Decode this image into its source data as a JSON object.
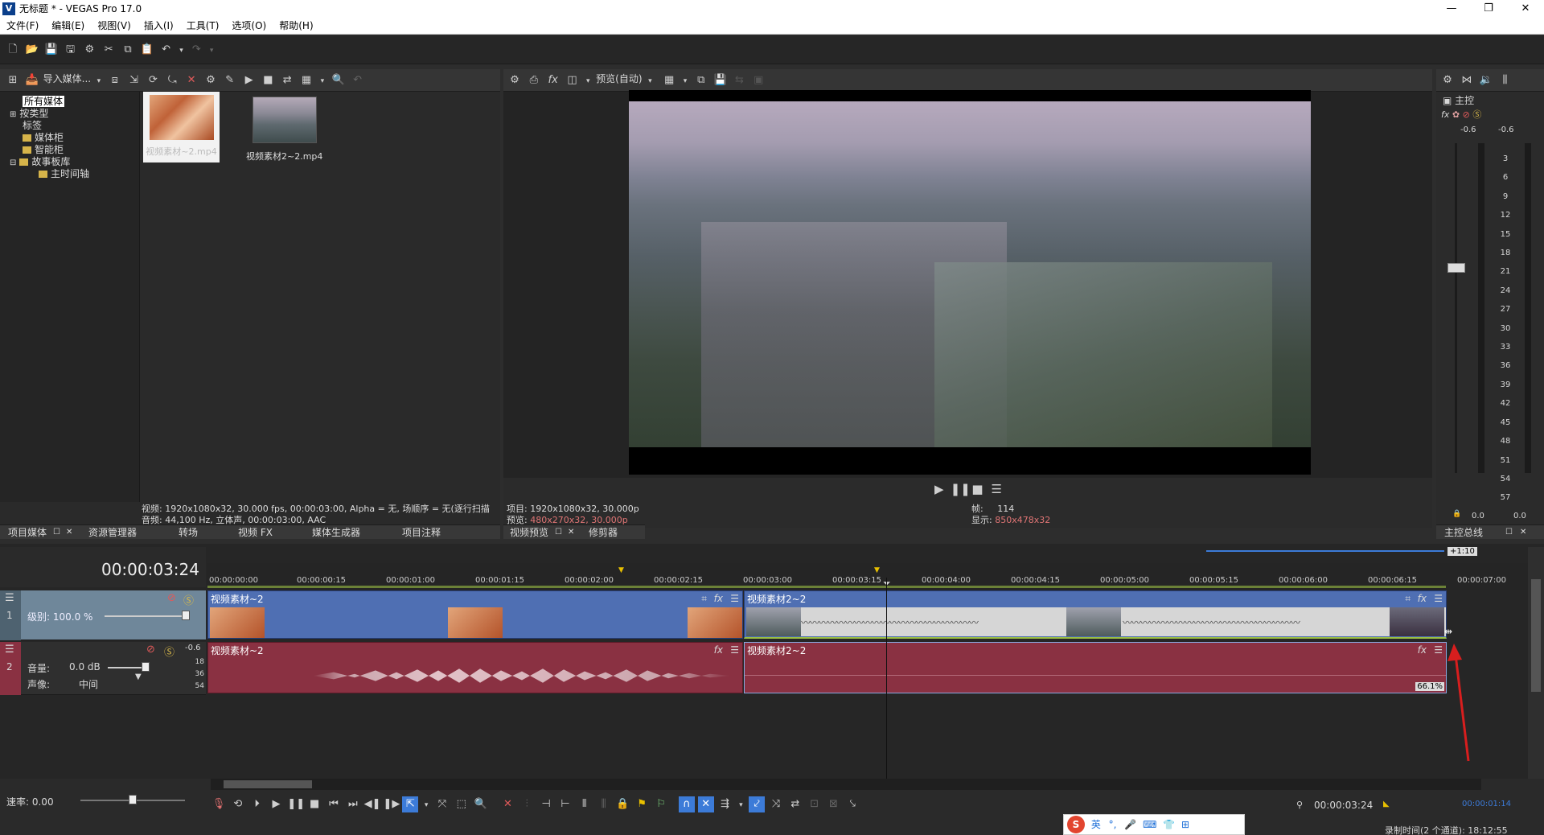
{
  "titlebar": {
    "title": "无标题 * - VEGAS Pro 17.0",
    "logo": "V"
  },
  "menu": [
    "文件(F)",
    "编辑(E)",
    "视图(V)",
    "插入(I)",
    "工具(T)",
    "选项(O)",
    "帮助(H)"
  ],
  "media_panel": {
    "import_label": "导入媒体...",
    "tree": [
      {
        "label": "所有媒体",
        "selected": true
      },
      {
        "label": "按类型"
      },
      {
        "label": "标签"
      },
      {
        "label": "媒体柜"
      },
      {
        "label": "智能柜"
      },
      {
        "label": "故事板库"
      },
      {
        "label": "主时间轴"
      }
    ],
    "thumbs": [
      {
        "label": "视频素材~2.mp4"
      },
      {
        "label": "视频素材2~2.mp4"
      }
    ],
    "info_video": "视频: 1920x1080x32, 30.000 fps, 00:00:03:00, Alpha = 无, 场顺序 = 无(逐行扫描",
    "info_audio": "音频: 44,100 Hz, 立体声, 00:00:03:00, AAC",
    "tabs": [
      "项目媒体",
      "资源管理器",
      "转场",
      "视频 FX",
      "媒体生成器",
      "项目注释"
    ]
  },
  "preview_panel": {
    "mode": "预览(自动)",
    "project": "项目: 1920x1080x32, 30.000p",
    "preview_label": "预览:",
    "preview_val": "480x270x32, 30.000p",
    "frame_label": "帧:",
    "frame_val": "114",
    "display_label": "显示:",
    "display_val": "850x478x32",
    "tabs": [
      "视频预览",
      "修剪器"
    ]
  },
  "master": {
    "label": "主控",
    "peak_l": "-0.6",
    "peak_r": "-0.6",
    "scale": [
      "3",
      "6",
      "9",
      "12",
      "15",
      "18",
      "21",
      "24",
      "27",
      "30",
      "33",
      "36",
      "39",
      "42",
      "45",
      "48",
      "51",
      "54",
      "57"
    ],
    "bottom_l": "0.0",
    "bottom_r": "0.0",
    "tab": "主控总线"
  },
  "timeline": {
    "timecode": "00:00:03:24",
    "zoom": "+1:10",
    "ruler": [
      "00:00:00:00",
      "00:00:00:15",
      "00:00:01:00",
      "00:00:01:15",
      "00:00:02:00",
      "00:00:02:15",
      "00:00:03:00",
      "00:00:03:15",
      "00:00:04:00",
      "00:00:04:15",
      "00:00:05:00",
      "00:00:05:15",
      "00:00:06:00",
      "00:00:06:15",
      "00:00:07:00"
    ],
    "video_track": {
      "num": "1",
      "level": "级别: 100.0 %"
    },
    "audio_track": {
      "num": "2",
      "volume_label": "音量:",
      "volume": "0.0 dB",
      "pan_label": "声像:",
      "pan": "中间",
      "peak": "-0.6",
      "scale": [
        "18",
        "36",
        "54"
      ]
    },
    "clips": {
      "v1": "视频素材~2",
      "v2": "视频素材2~2",
      "a1": "视频素材~2",
      "a2": "视频素材2~2",
      "a2_pct": "66.1%"
    },
    "rate": "速率: 0.00",
    "cursor_time": "00:00:03:24",
    "sel_end": "00:00:01:14",
    "record_time": "录制时间(2 个通道): 18:12:55"
  },
  "ime": {
    "label": "英"
  },
  "colors": {
    "video_clip": "#4f6fb3",
    "audio_clip": "#8a3142",
    "accent": "#3c7bd8"
  }
}
